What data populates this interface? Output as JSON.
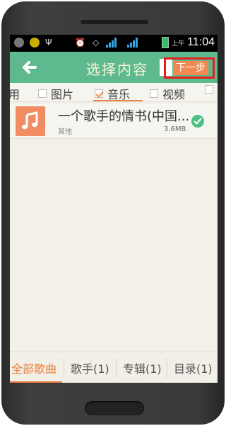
{
  "statusbar": {
    "time": "11:04",
    "ampm": "上午",
    "icons": [
      "usb-icon",
      "notification-icon",
      "alarm-icon",
      "wifi-icon",
      "signal-3g-icon",
      "signal-icon",
      "battery-icon"
    ],
    "network": "3G"
  },
  "titlebar": {
    "title": "选择内容",
    "next_label": "下一步",
    "back_icon": "arrow-left-icon"
  },
  "tabs": [
    {
      "label": "用",
      "checked": false
    },
    {
      "label": "图片",
      "checked": false
    },
    {
      "label": "音乐",
      "checked": true
    },
    {
      "label": "视频",
      "checked": false
    }
  ],
  "list": {
    "items": [
      {
        "title": "一个歌手的情书(中国...",
        "artist": "其他",
        "size": "3.6MB",
        "selected": true,
        "icon": "music-note-icon"
      }
    ]
  },
  "bottom_tabs": [
    {
      "label": "全部歌曲",
      "active": true
    },
    {
      "label": "歌手(1)",
      "active": false
    },
    {
      "label": "专辑(1)",
      "active": false
    },
    {
      "label": "目录(1)",
      "active": false
    }
  ],
  "colors": {
    "accent_green": "#5fb98f",
    "accent_orange": "#e97d3e",
    "highlight_red": "#e61e1e"
  }
}
